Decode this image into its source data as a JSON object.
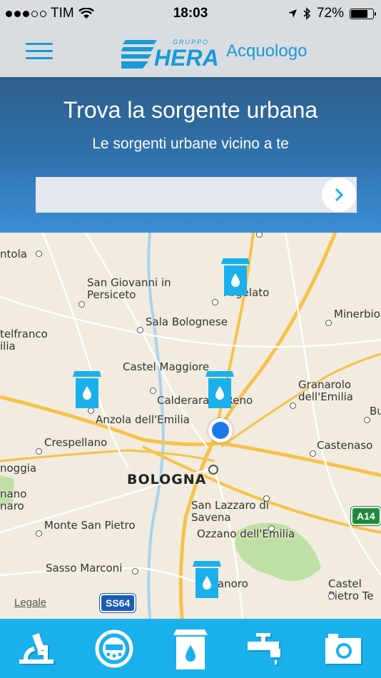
{
  "status": {
    "carrier": "TIM",
    "time": "18:03",
    "battery": "72%",
    "battery_level": 0.72
  },
  "header": {
    "brand_small": "GRUPPO",
    "brand": "HERA",
    "app_name": "Acquologo"
  },
  "hero": {
    "title": "Trova la sorgente urbana",
    "subtitle": "Le sorgenti urbane vicino a te",
    "search_value": "",
    "search_placeholder": ""
  },
  "map": {
    "places": [
      "ntola",
      "San Giovanni in Persiceto",
      "Argelato",
      "Minerbio",
      "telfranco ilia",
      "Sala Bolognese",
      "Castel Maggiore",
      "Granarolo dell'Emilia",
      "Calderara di Reno",
      "Bu",
      "Anzola dell'Emilia",
      "Crespellano",
      "Castenaso",
      "noggia",
      "BOLOGNA",
      "nano naro",
      "San Lazzaro di Savena",
      "Monte San Pietro",
      "Ozzano dell'Emilia",
      "Sasso Marconi",
      "Pianoro",
      "Castel Pietro Te"
    ],
    "road_labels": {
      "a14": "A14",
      "ss64": "SS64"
    },
    "legal": "Legale",
    "pins": [
      "water-source-pin-argelato",
      "water-source-pin-anzola",
      "water-source-pin-calderara",
      "water-source-pin-pianoro"
    ]
  },
  "tabs": [
    "lab-tab",
    "meter-tab",
    "water-source-tab",
    "tap-tab",
    "camera-tab"
  ],
  "colors": {
    "accent": "#1ab0ec",
    "brand": "#1a9ad7",
    "user_location": "#1b7ae8",
    "hero_top": "#2f5f8a",
    "hero_bottom": "#3c8fd6"
  }
}
